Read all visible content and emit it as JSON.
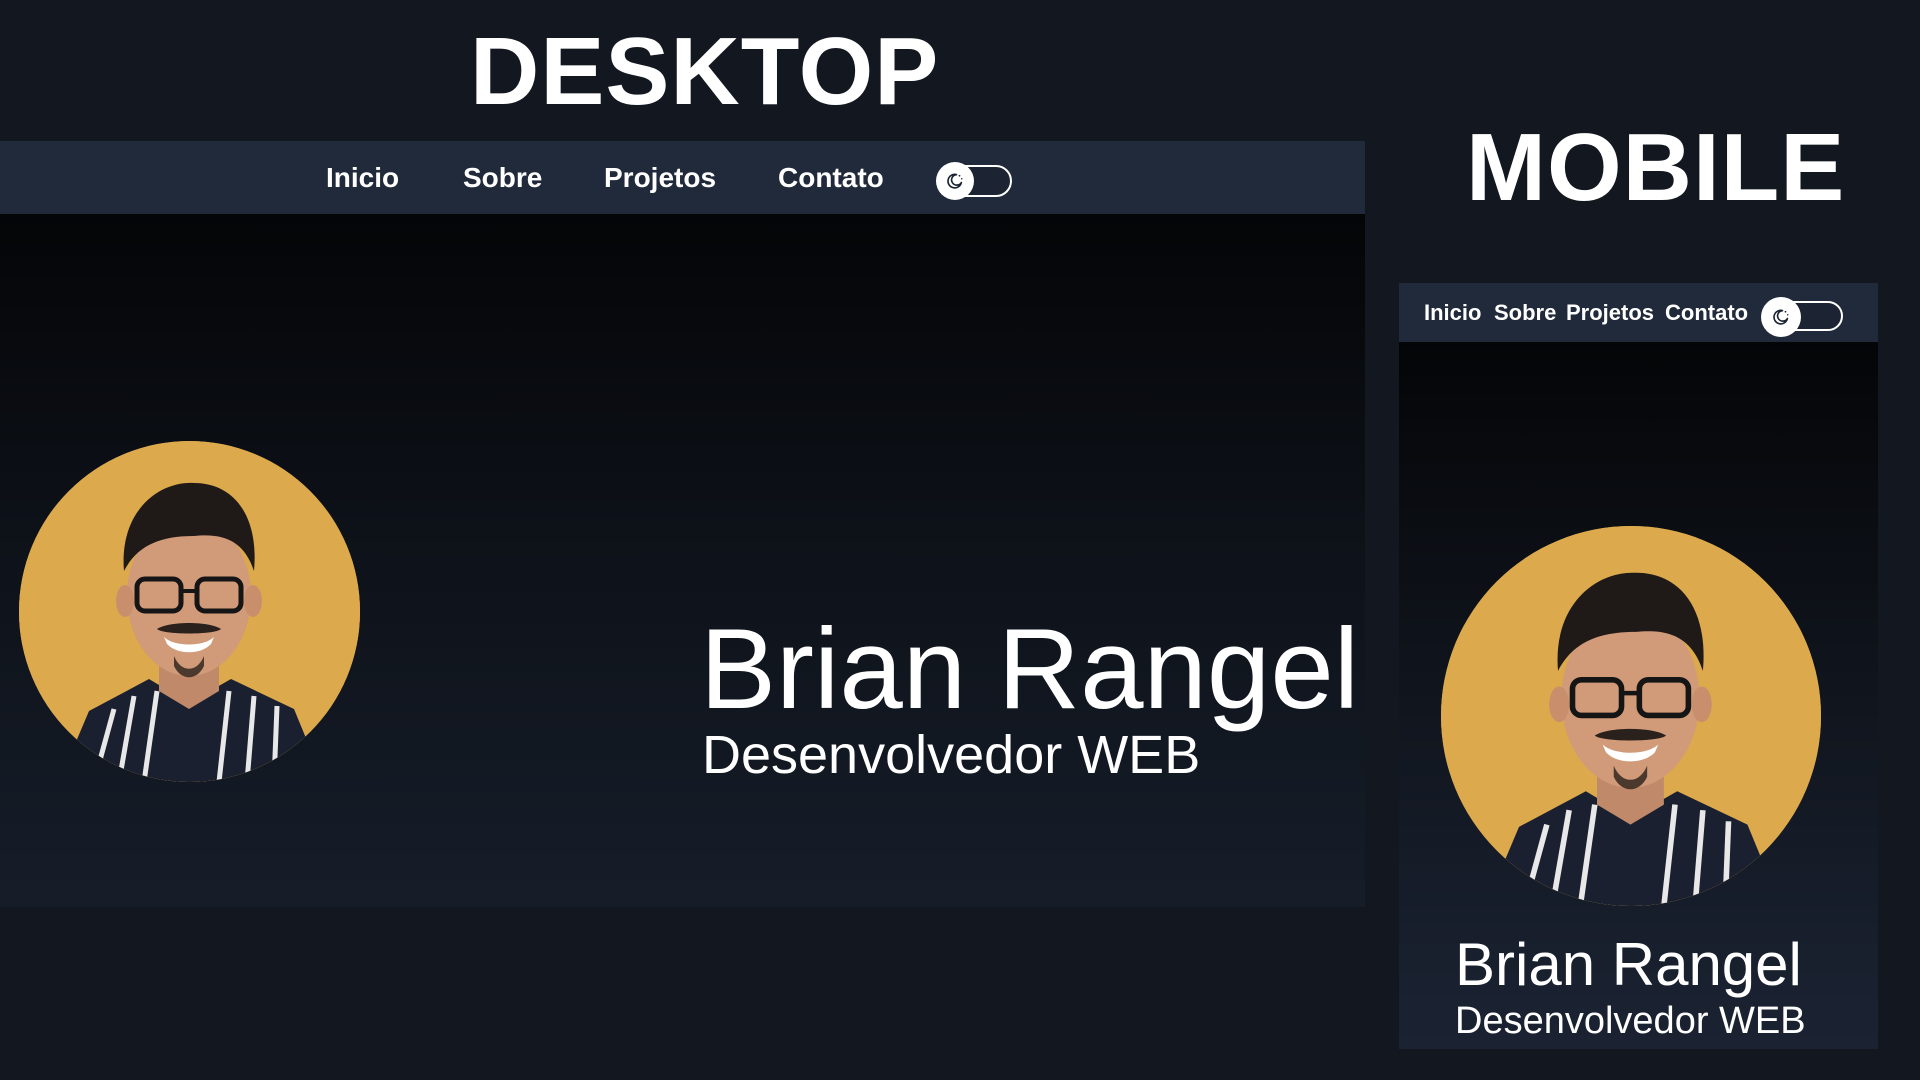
{
  "labels": {
    "desktop": "DESKTOP",
    "mobile": "MOBILE"
  },
  "desktop": {
    "nav": {
      "items": [
        {
          "label": "Inicio"
        },
        {
          "label": "Sobre"
        },
        {
          "label": "Projetos"
        },
        {
          "label": "Contato"
        }
      ],
      "theme_toggle": {
        "icon": "moon-icon",
        "state": "off"
      }
    },
    "hero": {
      "name": "Brian Rangel",
      "role": "Desenvolvedor WEB",
      "avatar": "profile-photo"
    }
  },
  "mobile": {
    "nav": {
      "items": [
        {
          "label": "Inicio"
        },
        {
          "label": "Sobre"
        },
        {
          "label": "Projetos"
        },
        {
          "label": "Contato"
        }
      ],
      "theme_toggle": {
        "icon": "moon-icon",
        "state": "off"
      }
    },
    "hero": {
      "name": "Brian Rangel",
      "role": "Desenvolvedor WEB",
      "avatar": "profile-photo"
    }
  },
  "colors": {
    "background": "#131820",
    "nav_background": "#212a3b",
    "avatar_background": "#dca94c",
    "text": "#ffffff"
  }
}
